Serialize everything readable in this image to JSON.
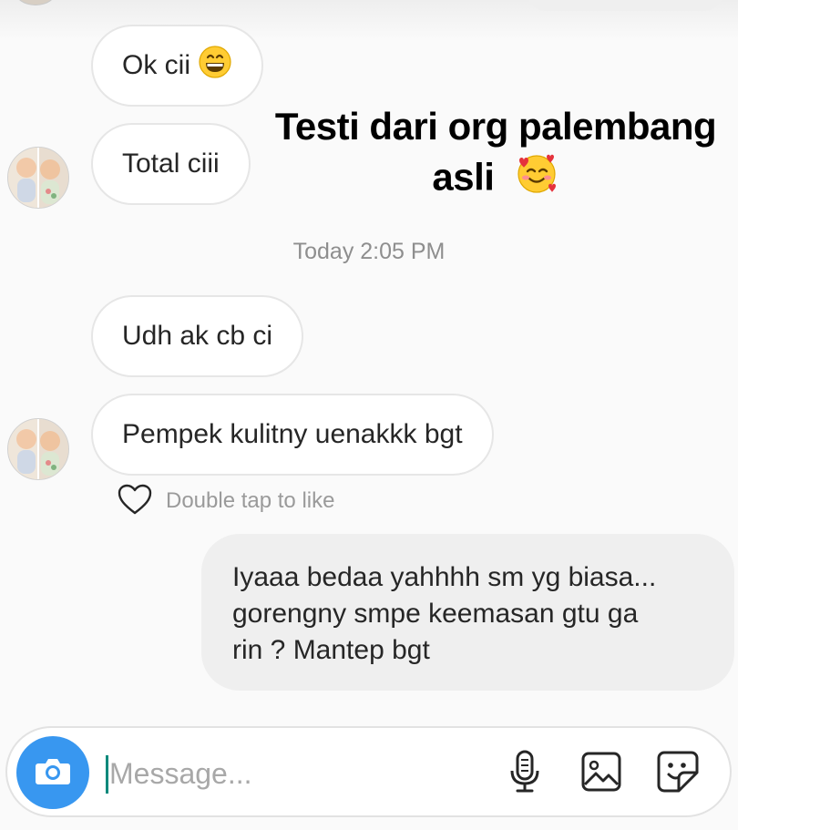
{
  "overlay": {
    "line1": "Testi dari org palembang",
    "line2": "asli",
    "emoji": "smiling-face-with-hearts"
  },
  "messages": {
    "m1": "Ok cii",
    "m1_emoji": "grinning-face",
    "m2": "Total ciii",
    "timestamp": "Today 2:05 PM",
    "m3": "Udh ak cb ci",
    "m4": "Pempek kulitny uenakkk bgt",
    "like_hint": "Double tap to like",
    "reply_line1": "Iyaaa bedaa yahhhh sm yg biasa...",
    "reply_line2": "gorengny smpe keemasan gtu ga",
    "reply_line3": "rin ? Mantep bgt"
  },
  "composer": {
    "placeholder": "Message...",
    "icons": [
      "camera-icon",
      "microphone-icon",
      "gallery-icon",
      "sticker-icon"
    ]
  },
  "colors": {
    "accent": "#3897f0",
    "incoming_bubble": "#ffffff",
    "outgoing_bubble": "#efefef",
    "caret": "#00897b"
  }
}
